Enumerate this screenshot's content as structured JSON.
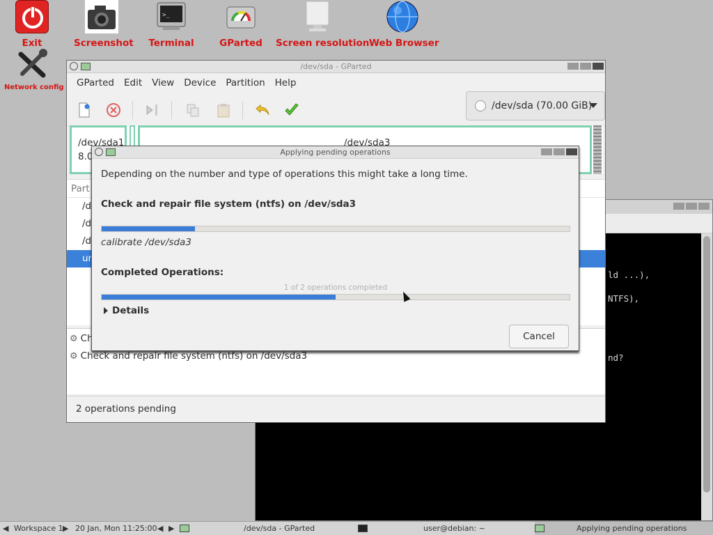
{
  "desktop": {
    "icons": [
      {
        "label": "Exit",
        "icon": "power-icon"
      },
      {
        "label": "Screenshot",
        "icon": "camera-icon"
      },
      {
        "label": "Terminal",
        "icon": "terminal-icon"
      },
      {
        "label": "GParted",
        "icon": "disk-gauge-icon"
      },
      {
        "label": "Screen resolution",
        "icon": "monitor-icon"
      },
      {
        "label": "Web Browser",
        "icon": "globe-icon"
      },
      {
        "label": "Network config",
        "icon": "wrench-icon"
      }
    ]
  },
  "terminal_window": {
    "lines": [
      "ld ...),",
      "NTFS),",
      "nd?"
    ]
  },
  "gparted": {
    "title": "/dev/sda - GParted",
    "menu": [
      "GParted",
      "Edit",
      "View",
      "Device",
      "Partition",
      "Help"
    ],
    "device_combo": "/dev/sda (70.00 GiB)",
    "partitions_map": [
      {
        "name": "/dev/sda1",
        "size": "8.0"
      },
      {
        "name": "/dev/sda3"
      }
    ],
    "list_header": "Part",
    "list_rows": [
      "/d",
      "/d",
      "/d",
      "ur"
    ],
    "operations": [
      "Ch",
      "Check and repair file system (ntfs) on /dev/sda3"
    ],
    "status": "2 operations pending"
  },
  "dialog": {
    "title": "Applying pending operations",
    "description": "Depending on the number and type of operations this might take a long time.",
    "current_operation": "Check and repair file system (ntfs) on /dev/sda3",
    "current_progress": 0.2,
    "sub_operation": "calibrate /dev/sda3",
    "completed_label": "Completed Operations:",
    "completed_text": "1 of 2 operations completed",
    "completed_progress": 0.5,
    "details_label": "Details",
    "cancel_label": "Cancel"
  },
  "taskbar": {
    "workspace": "Workspace 1",
    "datetime": "20 Jan, Mon 11:25:00",
    "tasks": [
      "/dev/sda - GParted",
      "user@debian: ~",
      "Applying pending operations"
    ]
  },
  "colors": {
    "desktop_label": "#d51515",
    "progress": "#3b7dd8",
    "selection": "#3b80d9",
    "partition_border": "#7fd0b1"
  }
}
